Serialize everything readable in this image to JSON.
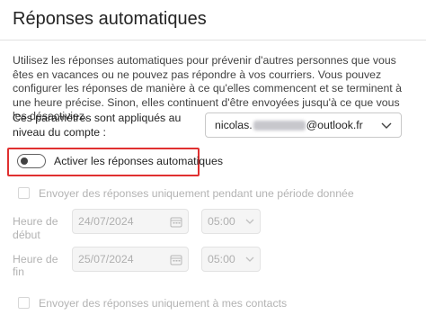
{
  "header": {
    "title": "Réponses automatiques"
  },
  "description": "Utilisez les réponses automatiques pour prévenir d'autres personnes que vous êtes en vacances ou ne pouvez pas répondre à vos courriers. Vous pouvez configurer les réponses de manière à ce qu'elles commencent et se terminent à une heure précise. Sinon, elles continuent d'être envoyées jusqu'à ce que vous les désactiviez.",
  "account": {
    "label": "Ces paramètres sont appliqués au niveau du compte :",
    "email_prefix": "nicolas.",
    "email_suffix": "@outlook.fr"
  },
  "toggle": {
    "label": "Activer les réponses automatiques",
    "on": false
  },
  "period": {
    "checkbox_label": "Envoyer des réponses uniquement pendant une période donnée",
    "start_label": "Heure de début",
    "start_date": "24/07/2024",
    "start_time": "05:00",
    "end_label": "Heure de fin",
    "end_date": "25/07/2024",
    "end_time": "05:00"
  },
  "contacts": {
    "checkbox_label": "Envoyer des réponses uniquement à mes contacts"
  },
  "colors": {
    "highlight": "#e03030",
    "disabled_text": "#b3b3b3"
  },
  "icons": {
    "dropdown": "chevron-down-icon",
    "calendar": "calendar-icon"
  }
}
